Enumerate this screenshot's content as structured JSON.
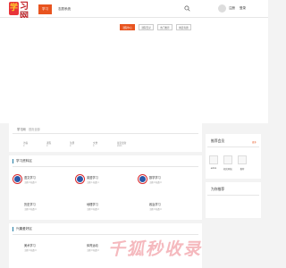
{
  "header": {
    "logo_mark": "学",
    "logo_text": "习网",
    "logo_sub": "Study & Learning",
    "nav": [
      "学习网",
      "志愿系统"
    ],
    "login": "注册",
    "register": "登录"
  },
  "hero": {
    "pills": [
      "课程中心",
      "课程目录",
      "热门推荐",
      "精选专题"
    ]
  },
  "breadcrumb": [
    "学习网",
    "首页全部"
  ],
  "stats": [
    {
      "label": "访客",
      "value": "0"
    },
    {
      "label": "课程",
      "value": "0"
    },
    {
      "label": "注册",
      "value": "0"
    },
    {
      "label": "文章",
      "value": "0"
    },
    {
      "label": "最近更新",
      "value": "2023"
    }
  ],
  "section1": {
    "title": "学习资料区",
    "cards": [
      {
        "title": "语文学习",
        "sub": "主题 0 帖数 0"
      },
      {
        "title": "英语学习",
        "sub": "主题 1 帖数 1"
      },
      {
        "title": "数学学习",
        "sub": "主题 0 帖数 0"
      },
      {
        "title": "历史学习",
        "sub": "主题 0 帖数 0"
      },
      {
        "title": "地理学习",
        "sub": "主题 0 帖数 0"
      },
      {
        "title": "政治学习",
        "sub": "主题 0 帖数 0"
      }
    ]
  },
  "section2": {
    "title": "兴趣爱好区",
    "cards": [
      {
        "title": "美术学习",
        "sub": "主题 0 帖数 0"
      },
      {
        "title": "体育运动",
        "sub": "主题 0 帖数 0"
      }
    ]
  },
  "sidebar": {
    "rec_title": "推荐会员",
    "more": "更多",
    "members": [
      "admin",
      "相关网站",
      "推荐"
    ],
    "hot_title": "为你推荐"
  },
  "watermark": "千狐秒收录"
}
